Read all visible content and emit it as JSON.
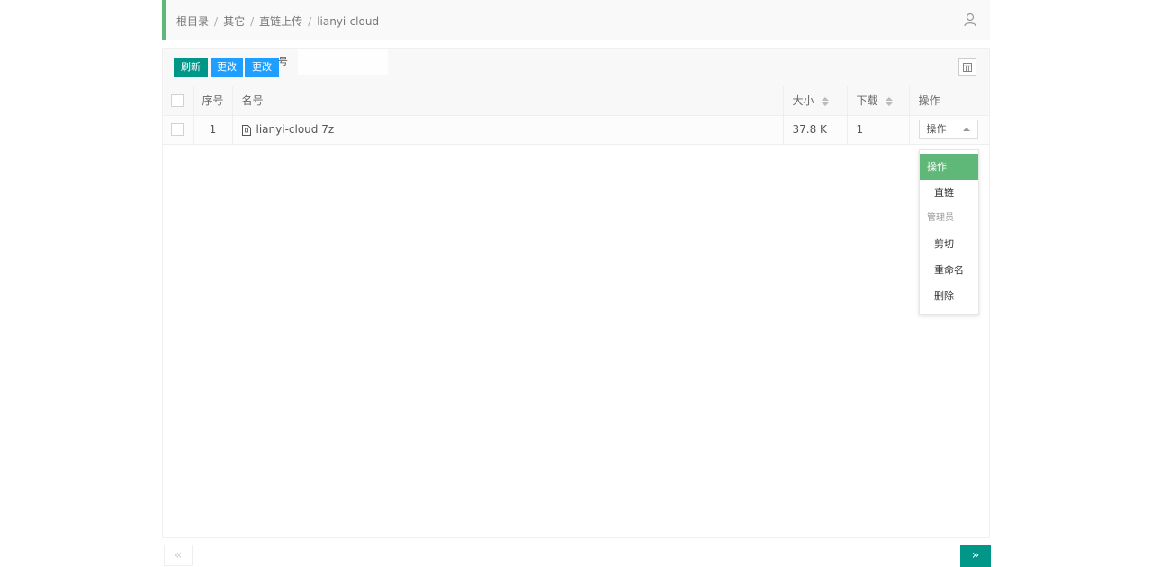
{
  "breadcrumb": {
    "items": [
      "根目录",
      "其它",
      "直链上传",
      "lianyi-cloud"
    ],
    "separator": "/"
  },
  "toolbar": {
    "refresh_label": "刷新",
    "change_label": "更改",
    "change2_label": "更改",
    "ghost_text": "号"
  },
  "table": {
    "headers": {
      "index": "序号",
      "name": "名号",
      "size": "大小",
      "downloads": "下载",
      "actions": "操作"
    },
    "rows": [
      {
        "index": "1",
        "name": "lianyi-cloud 7z",
        "size": "37.8 K",
        "downloads": "1",
        "action_label": "操作"
      }
    ]
  },
  "dropdown": {
    "active": "操作",
    "link": "直链",
    "group": "管理员",
    "cut": "剪切",
    "rename": "重命名",
    "delete": "删除"
  },
  "pagination": {
    "prev": "«",
    "next": "»"
  },
  "colors": {
    "accent_green": "#5fb878",
    "teal": "#009688",
    "blue": "#1e9fff"
  }
}
